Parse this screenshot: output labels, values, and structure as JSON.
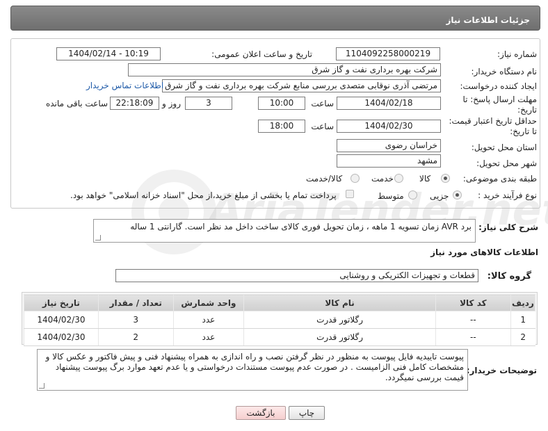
{
  "header": {
    "title": "جزئیات اطلاعات نیاز"
  },
  "form": {
    "need_number": {
      "label": "شماره نیاز:",
      "value": "1104092258000219"
    },
    "announce": {
      "label": "تاریخ و ساعت اعلان عمومی:",
      "value": "1404/02/14 - 10:19"
    },
    "buyer_org": {
      "label": "نام دستگاه خریدار:",
      "value": "شرکت بهره برداری نفت و گاز شرق"
    },
    "creator": {
      "label": "ایجاد کننده درخواست:",
      "value": "مرتضی آذری نوقابی متصدی بررسی منابع شرکت بهره برداری نفت و گاز شرق",
      "contact_link": "اطلاعات تماس خریدار"
    },
    "deadline": {
      "label_line1": "مهلت ارسال پاسخ: تا",
      "label_line2": "تاریخ:",
      "date": "1404/02/18",
      "time_label": "ساعت",
      "time": "10:00",
      "days": "3",
      "days_label": "روز و",
      "remaining": "22:18:09",
      "remaining_label": "ساعت باقی مانده"
    },
    "validity": {
      "label_line1": "حداقل تاریخ اعتبار قیمت:",
      "label_line2": "تا تاریخ:",
      "date": "1404/02/30",
      "time_label": "ساعت",
      "time": "18:00"
    },
    "province": {
      "label": "استان محل تحویل:",
      "value": "خراسان رضوی"
    },
    "city": {
      "label": "شهر محل تحویل:",
      "value": "مشهد"
    },
    "category": {
      "label": "طبقه بندی موضوعی:",
      "options": [
        "کالا",
        "خدمت",
        "کالا/خدمت"
      ],
      "selected": "کالا"
    },
    "process": {
      "label": "نوع فرآیند خرید :",
      "options": [
        "جزیی",
        "متوسط"
      ],
      "selected": "جزیی",
      "payment_note": "پرداخت تمام یا بخشی از مبلغ خرید،از محل \"اسناد خزانه اسلامی\" خواهد بود."
    }
  },
  "description": {
    "label": "شرح کلی نیاز:",
    "text": "برد AVR زمان تسویه 1 ماهه ، زمان تحویل فوری کالای ساخت داخل مد نظر است. گارانتی 1 ساله"
  },
  "goods": {
    "section_title": "اطلاعات کالاهای مورد نیاز",
    "group_label": "گروه کالا:",
    "group_value": "قطعات و تجهیزات الکتریکی و روشنایی",
    "columns": [
      "ردیف",
      "کد کالا",
      "نام کالا",
      "واحد شمارش",
      "تعداد / مقدار",
      "تاریخ نیاز"
    ],
    "rows": [
      {
        "row": "1",
        "code": "--",
        "name": "رگلاتور قدرت",
        "unit": "عدد",
        "qty": "3",
        "date": "1404/02/30"
      },
      {
        "row": "2",
        "code": "--",
        "name": "رگلاتور قدرت",
        "unit": "عدد",
        "qty": "2",
        "date": "1404/02/30"
      }
    ]
  },
  "buyer_notes": {
    "label": "توضیحات خریدار:",
    "text": "پیوست تاییدیه فایل پیوست به منظور در نظر گرفتن نصب و راه اندازی  به همراه پیشنهاد فنی و پیش فاکتور و عکس کالا و مشخصات کامل فنی الزامیست . در صورت عدم پیوست مستندات درخواستی و یا عدم تعهد موارد برگ پیوست پیشنهاد قیمت بررسی نمیگردد."
  },
  "buttons": {
    "print": "چاپ",
    "back": "بازگشت"
  },
  "watermark": {
    "text": "AriaTender.net"
  },
  "colors": {
    "header_bg": "#7a7a7a",
    "link": "#1e5aa8",
    "back_button": "#f6cfcf"
  }
}
